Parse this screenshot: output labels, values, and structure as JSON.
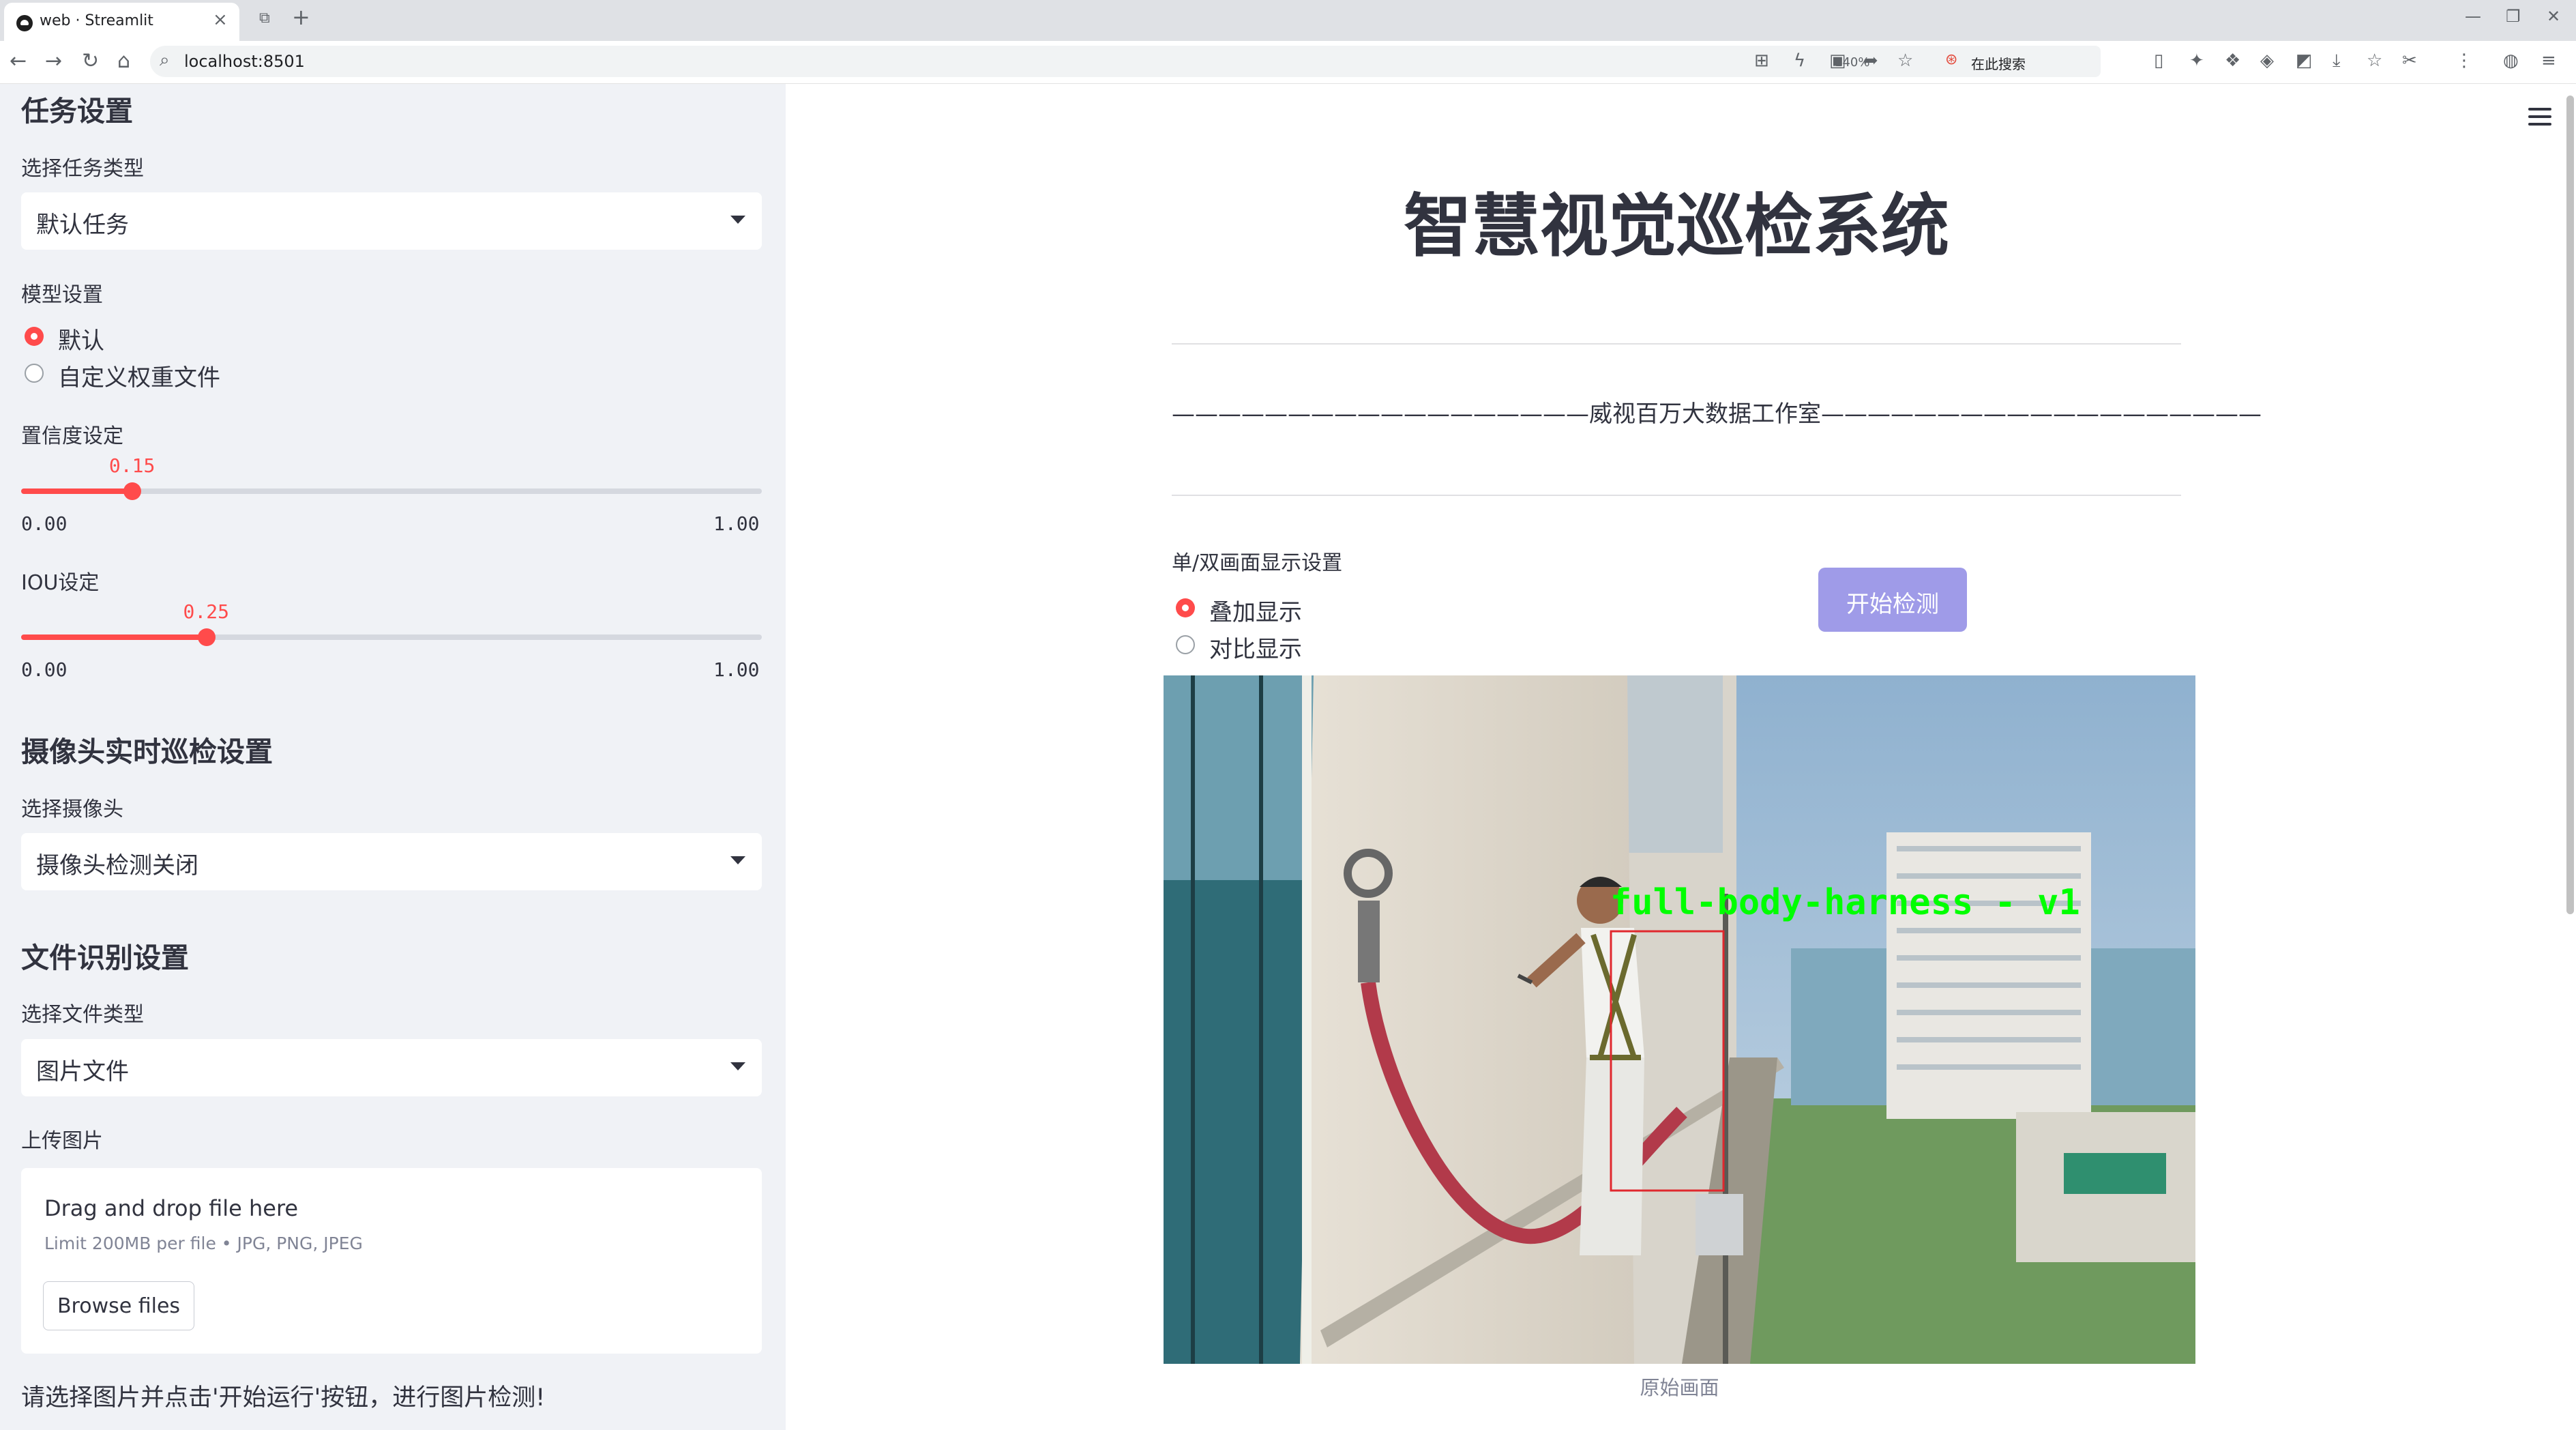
{
  "browser": {
    "tab_title": "web · Streamlit",
    "url": "localhost:8501",
    "zoom": "140%",
    "search_placeholder": "在此搜索"
  },
  "sidebar": {
    "task_header": "任务设置",
    "task_type_label": "选择任务类型",
    "task_type_value": "默认任务",
    "model_label": "模型设置",
    "model_options": [
      "默认",
      "自定义权重文件"
    ],
    "model_selected": "默认",
    "confidence_label": "置信度设定",
    "confidence": {
      "value": "0.15",
      "min": "0.00",
      "max": "1.00",
      "fraction": 0.15
    },
    "iou_label": "IOU设定",
    "iou": {
      "value": "0.25",
      "min": "0.00",
      "max": "1.00",
      "fraction": 0.25
    },
    "camera_header": "摄像头实时巡检设置",
    "camera_label": "选择摄像头",
    "camera_value": "摄像头检测关闭",
    "file_header": "文件识别设置",
    "file_type_label": "选择文件类型",
    "file_type_value": "图片文件",
    "upload_label": "上传图片",
    "uploader": {
      "drop_text": "Drag and drop file here",
      "limit_text": "Limit 200MB per file • JPG, PNG, JPEG",
      "browse_label": "Browse files"
    },
    "hint": "请选择图片并点击'开始运行'按钮，进行图片检测!"
  },
  "main": {
    "title": "智慧视觉巡检系统",
    "subtitle": "——————————————————威视百万大数据工作室———————————————————",
    "display_label": "单/双画面显示设置",
    "display_options": [
      "叠加显示",
      "对比显示"
    ],
    "display_selected": "叠加显示",
    "start_button": "开始检测",
    "detection_label": "full-body-harness - v1",
    "image_caption": "原始画面"
  },
  "colors": {
    "accent": "#ff4b4b",
    "start_button": "#9f9be8",
    "sidebar_bg": "#f0f2f6",
    "detection_box": "#e0282e",
    "detection_text": "#00ff00"
  }
}
